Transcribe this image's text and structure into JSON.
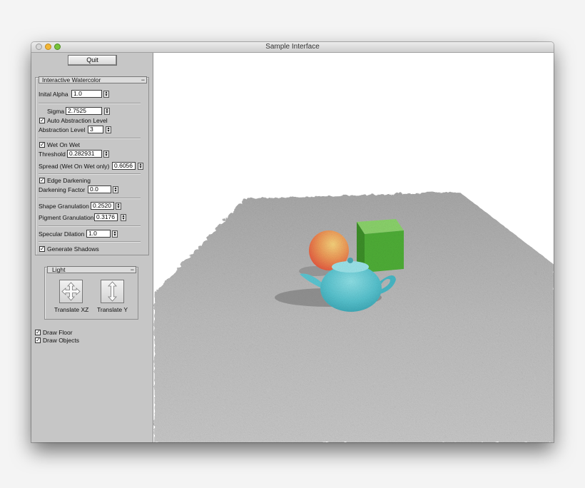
{
  "window": {
    "title": "Sample Interface"
  },
  "panel": {
    "quit_label": "Quit",
    "watercolor": {
      "title": "Interactive Watercolor",
      "collapse": "−",
      "initial_alpha": {
        "label": "Inital Alpha",
        "value": "1.0"
      },
      "sigma": {
        "label": "Sigma",
        "value": "2.7525"
      },
      "auto_abstraction": {
        "label": "Auto Abstraction Level",
        "checked": true
      },
      "abstraction_level": {
        "label": "Abstraction Level",
        "value": "3"
      },
      "wet_on_wet": {
        "label": "Wet On Wet",
        "checked": true
      },
      "threshold": {
        "label": "Threshold",
        "value": "0.282931"
      },
      "spread": {
        "label": "Spread (Wet On Wet only)",
        "value": "0.6056"
      },
      "edge_darkening": {
        "label": "Edge Darkening",
        "checked": true
      },
      "darkening_factor": {
        "label": "Darkening Factor",
        "value": "0.0"
      },
      "shape_granulation": {
        "label": "Shape Granulation",
        "value": "0.2520"
      },
      "pigment_granulation": {
        "label": "Pigment Granulation",
        "value": "0.3176"
      },
      "specular_dilation": {
        "label": "Specular Dilation",
        "value": "1.0"
      },
      "generate_shadows": {
        "label": "Generate Shadows",
        "checked": true
      }
    },
    "light": {
      "title": "Light",
      "collapse": "−",
      "translate_xz": "Translate XZ",
      "translate_y": "Translate Y"
    },
    "draw_floor": {
      "label": "Draw Floor",
      "checked": true
    },
    "draw_objects": {
      "label": "Draw Objects",
      "checked": true
    }
  },
  "colors": {
    "viewport_bg": "#ffffff",
    "floor": "#b5b5b5",
    "sphere": "#ec7e4d",
    "cube": "#52b43a",
    "teapot": "#52c3d0"
  },
  "icons": [
    "move-arrows-icon",
    "vertical-arrow-icon",
    "checkmark-icon",
    "spinner-arrows-icon"
  ]
}
